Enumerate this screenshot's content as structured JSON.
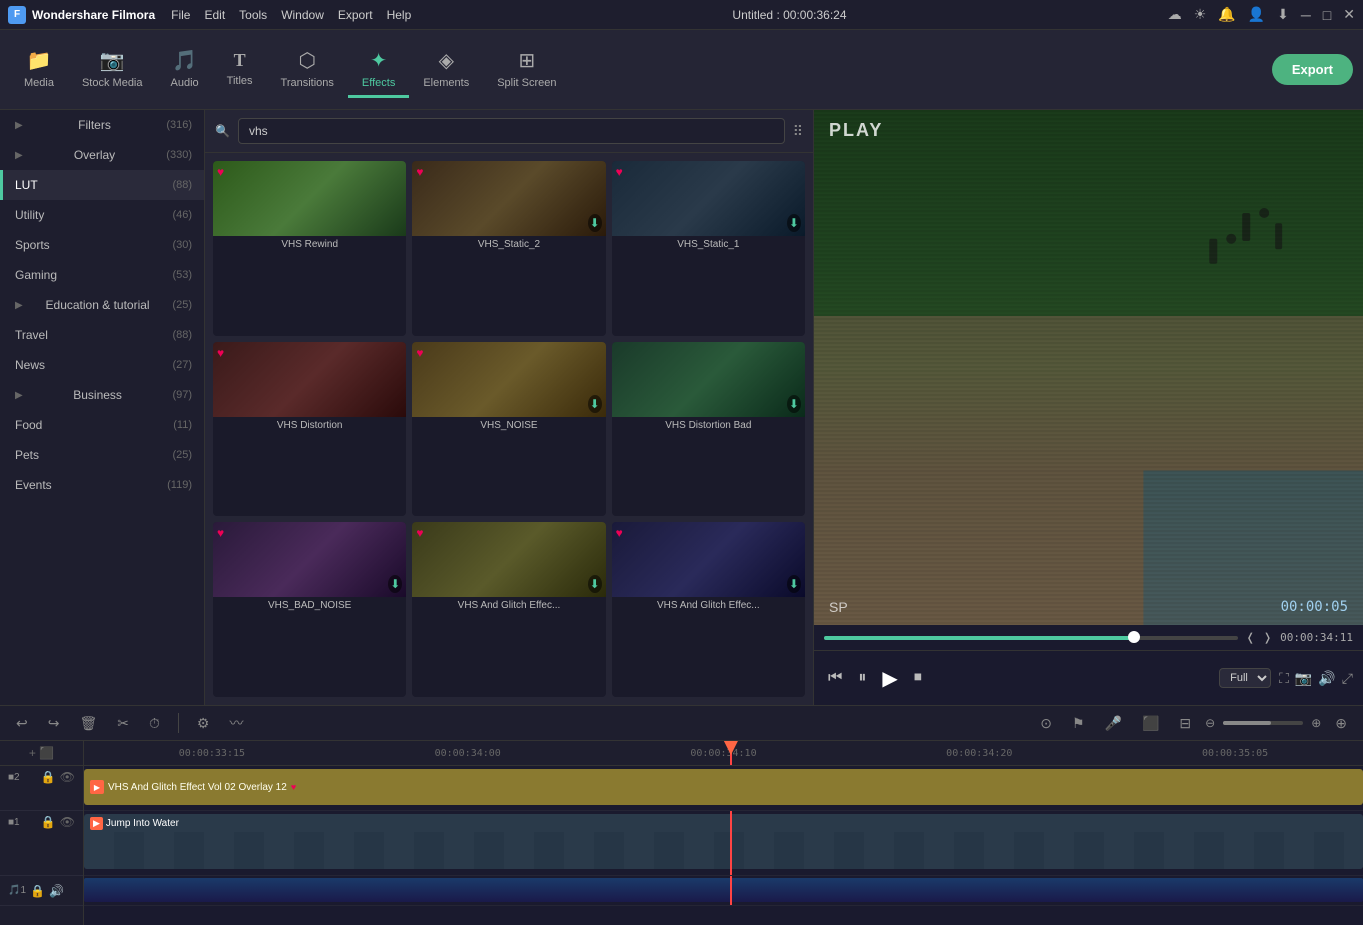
{
  "app": {
    "name": "Wondershare Filmora",
    "title": "Untitled : 00:00:36:24"
  },
  "menubar": {
    "items": [
      "File",
      "Edit",
      "Tools",
      "Window",
      "Export",
      "Help"
    ]
  },
  "toolbar": {
    "items": [
      {
        "id": "media",
        "label": "Media",
        "icon": "📁"
      },
      {
        "id": "stock",
        "label": "Stock Media",
        "icon": "📷"
      },
      {
        "id": "audio",
        "label": "Audio",
        "icon": "🎵"
      },
      {
        "id": "titles",
        "label": "Titles",
        "icon": "T"
      },
      {
        "id": "transitions",
        "label": "Transitions",
        "icon": "⬡"
      },
      {
        "id": "effects",
        "label": "Effects",
        "icon": "✦"
      },
      {
        "id": "elements",
        "label": "Elements",
        "icon": "◈"
      },
      {
        "id": "splitscreen",
        "label": "Split Screen",
        "icon": "⊞"
      }
    ],
    "export_label": "Export"
  },
  "sidebar": {
    "items": [
      {
        "label": "Filters",
        "count": "(316)",
        "expandable": true
      },
      {
        "label": "Overlay",
        "count": "(330)",
        "expandable": true
      },
      {
        "label": "LUT",
        "count": "(88)",
        "active": true
      },
      {
        "label": "Utility",
        "count": "(46)"
      },
      {
        "label": "Sports",
        "count": "(30)"
      },
      {
        "label": "Gaming",
        "count": "(53)"
      },
      {
        "label": "Education & tutorial",
        "count": "(25)",
        "expandable": true
      },
      {
        "label": "Travel",
        "count": "(88)"
      },
      {
        "label": "News",
        "count": "(27)"
      },
      {
        "label": "Business",
        "count": "(97)",
        "expandable": true
      },
      {
        "label": "Food",
        "count": "(11)"
      },
      {
        "label": "Pets",
        "count": "(25)"
      },
      {
        "label": "Events",
        "count": "(119)"
      }
    ]
  },
  "search": {
    "placeholder": "vhs",
    "value": "vhs"
  },
  "effects": [
    {
      "name": "VHS Rewind",
      "thumb": "thumb1",
      "favorite": true,
      "download": false
    },
    {
      "name": "VHS_Static_2",
      "thumb": "thumb2",
      "favorite": true,
      "download": true
    },
    {
      "name": "VHS_Static_1",
      "thumb": "thumb3",
      "favorite": true,
      "download": true
    },
    {
      "name": "VHS Distortion",
      "thumb": "thumb4",
      "favorite": true,
      "download": false
    },
    {
      "name": "VHS_NOISE",
      "thumb": "thumb5",
      "favorite": true,
      "download": true
    },
    {
      "name": "VHS Distortion Bad",
      "thumb": "thumb6",
      "favorite": false,
      "download": true
    },
    {
      "name": "VHS_BAD_NOISE",
      "thumb": "thumb7",
      "favorite": true,
      "download": true
    },
    {
      "name": "VHS And Glitch Effec...",
      "thumb": "thumb8",
      "favorite": true,
      "download": true
    },
    {
      "name": "VHS And Glitch Effec...",
      "thumb": "thumb9",
      "favorite": true,
      "download": true
    }
  ],
  "preview": {
    "label": "PLAY",
    "sp_label": "SP",
    "time_code": "00:00:05",
    "duration": "00:00:34:11",
    "zoom": "Full",
    "progress_pct": 75
  },
  "timeline": {
    "ruler_marks": [
      "00:00:33:15",
      "00:00:34:00",
      "00:00:34:10",
      "00:00:34:20",
      "00:00:35:05"
    ],
    "playhead_time": "00:00:34:10",
    "tracks": [
      {
        "type": "overlay",
        "num": "2",
        "clip_label": "VHS And Glitch Effect Vol 02 Overlay 12"
      },
      {
        "type": "video",
        "num": "1",
        "clip_label": "Jump Into Water"
      },
      {
        "type": "audio",
        "num": "1"
      }
    ]
  },
  "icons": {
    "undo": "↩",
    "redo": "↪",
    "delete": "🗑",
    "cut": "✂",
    "clock": "⏱",
    "sliders": "⚙",
    "waveform": "〰",
    "lock": "🔒",
    "eye": "👁",
    "microphone": "🎤",
    "expand": "⬛",
    "grid": "⊞",
    "zoom_in": "⊕",
    "zoom_out": "⊖",
    "fullscreen": "⛶",
    "camera": "📷",
    "volume": "🔊",
    "expand2": "⤢"
  }
}
